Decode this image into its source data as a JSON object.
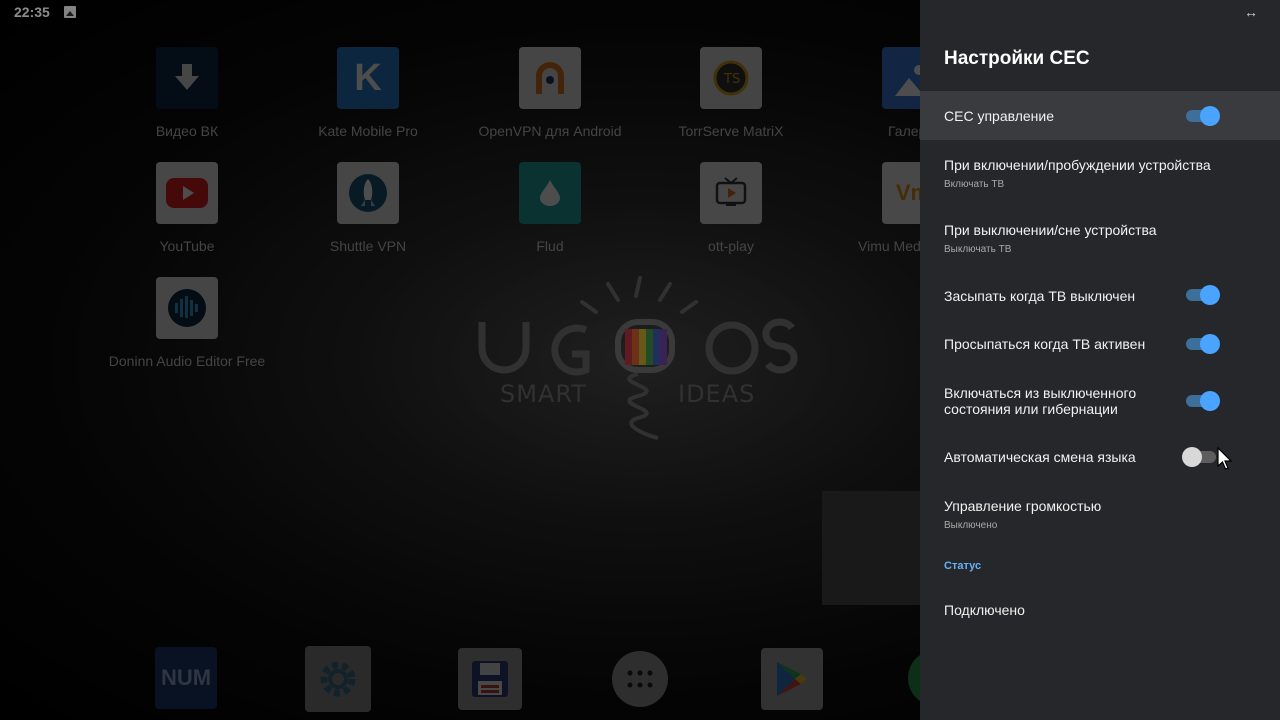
{
  "status_bar": {
    "time": "22:35"
  },
  "launcher": {
    "apps": [
      {
        "label": "Видео ВК",
        "icon": "download-arrow-icon"
      },
      {
        "label": "Kate Mobile Pro",
        "icon": "kate-k-icon"
      },
      {
        "label": "OpenVPN для Android",
        "icon": "openvpn-icon"
      },
      {
        "label": "TorrServe MatriX",
        "icon": "torrserve-icon"
      },
      {
        "label": "Галер",
        "icon": "gallery-icon"
      },
      {
        "label": "YouTube",
        "icon": "youtube-icon"
      },
      {
        "label": "Shuttle VPN",
        "icon": "rocket-icon"
      },
      {
        "label": "Flud",
        "icon": "droplet-icon"
      },
      {
        "label": "ott-play",
        "icon": "tv-play-icon"
      },
      {
        "label": "Vimu Medi",
        "icon": "vimu-icon"
      },
      {
        "label": "Doninn Audio Editor Free",
        "icon": "audio-editor-icon"
      }
    ],
    "logo": {
      "main": "UG  OS",
      "sub_left": "SMART",
      "sub_right": "IDEAS"
    },
    "dock": [
      {
        "label": "NUM",
        "icon": "num-icon"
      },
      {
        "label": "",
        "icon": "settings-gear-icon"
      },
      {
        "label": "",
        "icon": "floppy-icon"
      },
      {
        "label": "",
        "icon": "all-apps-icon"
      },
      {
        "label": "",
        "icon": "play-store-icon"
      },
      {
        "label": "",
        "icon": "chrome-icon"
      }
    ]
  },
  "panel": {
    "title": "Настройки CEC",
    "rows": [
      {
        "title": "CEC управление",
        "toggle": true
      },
      {
        "title": "При включении/пробуждении устройства",
        "subtitle": "Включать ТВ"
      },
      {
        "title": "При выключении/сне устройства",
        "subtitle": "Выключать ТВ"
      },
      {
        "title": "Засыпать когда ТВ выключен",
        "toggle": true
      },
      {
        "title": "Просыпаться когда ТВ активен",
        "toggle": true
      },
      {
        "title_line1": "Включаться из выключенного",
        "title_line2": "состояния или гибернации",
        "toggle": true
      },
      {
        "title": "Автоматическая смена языка",
        "toggle": false
      },
      {
        "title": "Управление громкостью",
        "subtitle": "Выключено"
      }
    ],
    "section_status": "Статус",
    "status_value": "Подключено",
    "colors": {
      "accent": "#4aa3ff",
      "panel_bg": "#26272a",
      "section": "#67b0f5"
    }
  }
}
